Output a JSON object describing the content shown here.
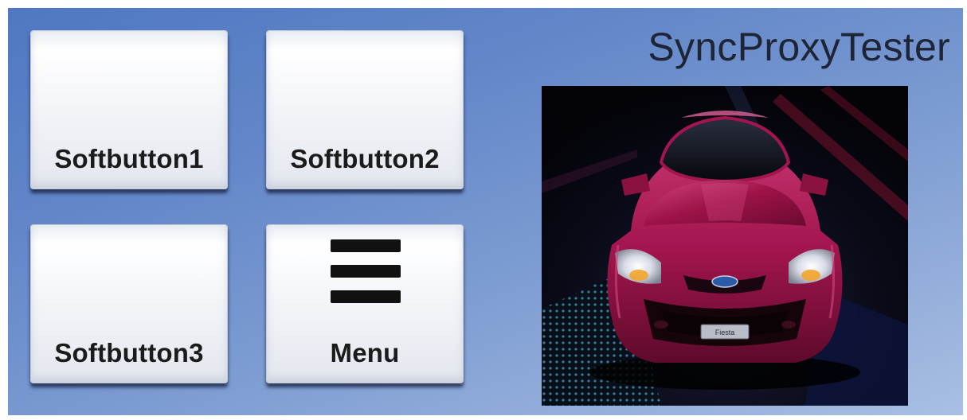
{
  "app": {
    "title": "SyncProxyTester"
  },
  "softbuttons": [
    {
      "label": "Softbutton1"
    },
    {
      "label": "Softbutton2"
    },
    {
      "label": "Softbutton3"
    },
    {
      "label": "Menu",
      "icon": "hamburger-menu-icon"
    }
  ],
  "graphic": {
    "subject": "car-front-image",
    "plate_text": "Fiesta"
  },
  "colors": {
    "background_top": "#4f78c2",
    "background_bottom": "#a9bfe3",
    "button_face": "#f1f3f7",
    "label_text": "#1b1b1b",
    "car_body": "#a3154e"
  }
}
